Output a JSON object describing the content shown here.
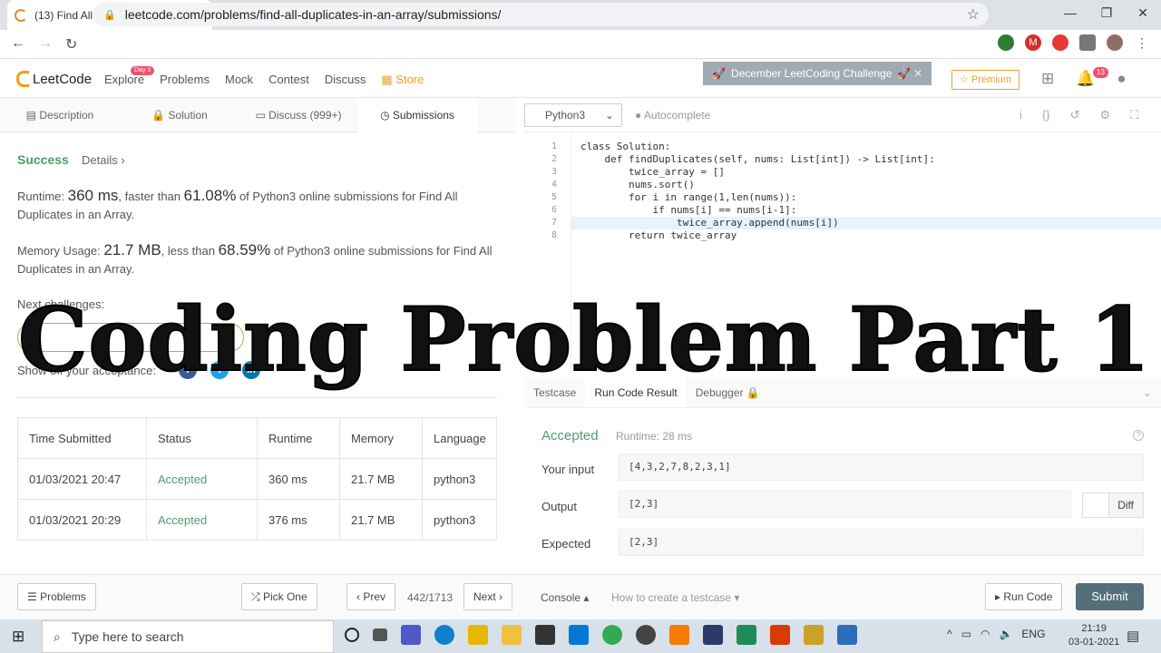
{
  "browser": {
    "tab_title": "(13) Find All Duplicates in an Arra",
    "url": "leetcode.com/problems/find-all-duplicates-in-an-array/submissions/"
  },
  "header": {
    "logo": "LeetCode",
    "menu": [
      "Explore",
      "Problems",
      "Mock",
      "Contest",
      "Discuss",
      "Store"
    ],
    "explore_badge": "Day 3",
    "challenge": "December LeetCoding Challenge",
    "premium": "Premium",
    "notif_count": "13"
  },
  "left_tabs": [
    "Description",
    "Solution",
    "Discuss (999+)",
    "Submissions"
  ],
  "result": {
    "status": "Success",
    "details": "Details",
    "runtime_label": "Runtime: ",
    "runtime": "360 ms",
    "runtime_mid": ", faster than ",
    "runtime_pct": "61.08%",
    "runtime_tail": " of Python3 online submissions for Find All Duplicates in an Array.",
    "memory_label": "Memory Usage: ",
    "memory": "21.7 MB",
    "memory_mid": ", less than ",
    "memory_pct": "68.59%",
    "memory_tail": " of Python3 online submissions for Find All Duplicates in an Array.",
    "next_label": "Next challenges:",
    "show_off": "Show off your acceptance:"
  },
  "table": {
    "headers": [
      "Time Submitted",
      "Status",
      "Runtime",
      "Memory",
      "Language"
    ],
    "rows": [
      [
        "01/03/2021 20:47",
        "Accepted",
        "360 ms",
        "21.7 MB",
        "python3"
      ],
      [
        "01/03/2021 20:29",
        "Accepted",
        "376 ms",
        "21.7 MB",
        "python3"
      ]
    ]
  },
  "editor": {
    "language": "Python3",
    "autocomplete": "Autocomplete",
    "lines": [
      "class Solution:",
      "    def findDuplicates(self, nums: List[int]) -> List[int]:",
      "        twice_array = []",
      "        nums.sort()",
      "        for i in range(1,len(nums)):",
      "            if nums[i] == nums[i-1]:",
      "                twice_array.append(nums[i])",
      "        return twice_array"
    ]
  },
  "console": {
    "tabs": [
      "Testcase",
      "Run Code Result",
      "Debugger"
    ],
    "accepted": "Accepted",
    "runtime": "Runtime: 28 ms",
    "input_label": "Your input",
    "input": "[4,3,2,7,8,2,3,1]",
    "output_label": "Output",
    "output": "[2,3]",
    "expected_label": "Expected",
    "expected": "[2,3]",
    "diff": "Diff"
  },
  "bottom": {
    "problems": "Problems",
    "pick_one": "Pick One",
    "prev": "Prev",
    "page": "442/1713",
    "next": "Next",
    "console": "Console",
    "howto": "How to create a testcase",
    "run": "Run Code",
    "submit": "Submit"
  },
  "taskbar": {
    "search": "Type here to search",
    "lang": "ENG",
    "time": "21:19",
    "date": "03-01-2021"
  },
  "overlay": "Coding Problem Part 1"
}
